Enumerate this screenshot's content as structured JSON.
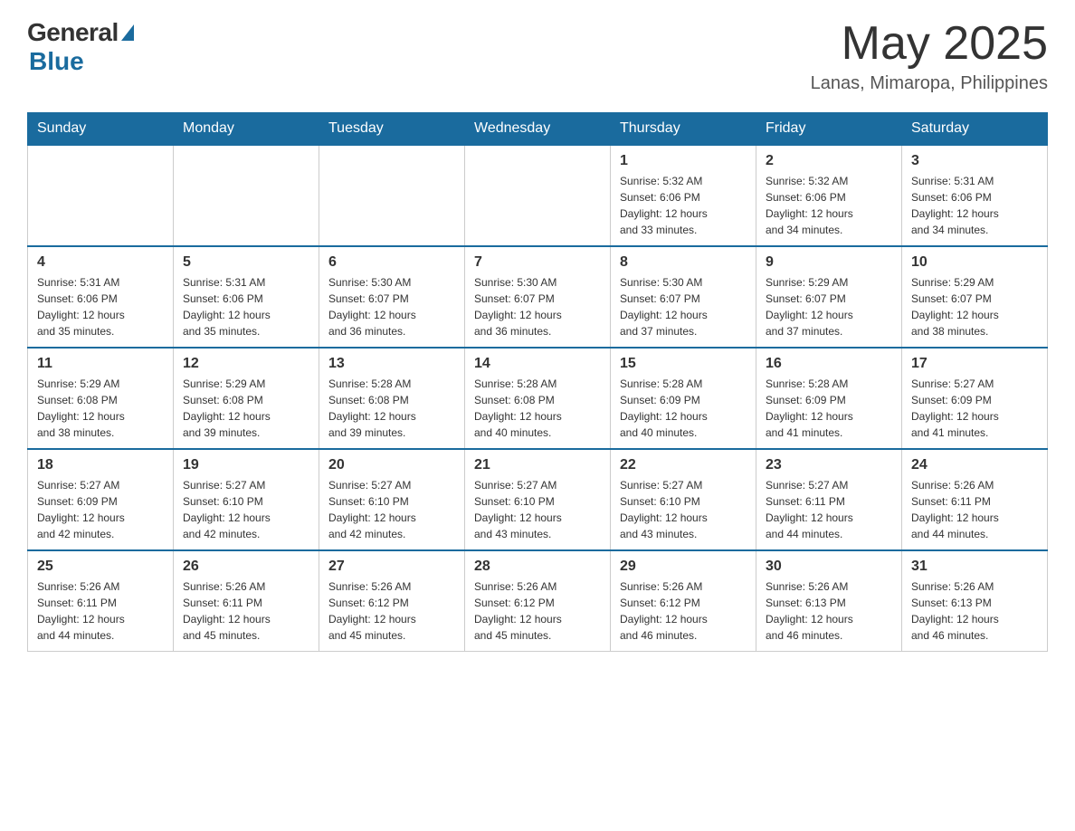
{
  "header": {
    "logo_general": "General",
    "logo_blue": "Blue",
    "month_title": "May 2025",
    "location": "Lanas, Mimaropa, Philippines"
  },
  "weekdays": [
    "Sunday",
    "Monday",
    "Tuesday",
    "Wednesday",
    "Thursday",
    "Friday",
    "Saturday"
  ],
  "weeks": [
    [
      {
        "day": "",
        "info": ""
      },
      {
        "day": "",
        "info": ""
      },
      {
        "day": "",
        "info": ""
      },
      {
        "day": "",
        "info": ""
      },
      {
        "day": "1",
        "info": "Sunrise: 5:32 AM\nSunset: 6:06 PM\nDaylight: 12 hours\nand 33 minutes."
      },
      {
        "day": "2",
        "info": "Sunrise: 5:32 AM\nSunset: 6:06 PM\nDaylight: 12 hours\nand 34 minutes."
      },
      {
        "day": "3",
        "info": "Sunrise: 5:31 AM\nSunset: 6:06 PM\nDaylight: 12 hours\nand 34 minutes."
      }
    ],
    [
      {
        "day": "4",
        "info": "Sunrise: 5:31 AM\nSunset: 6:06 PM\nDaylight: 12 hours\nand 35 minutes."
      },
      {
        "day": "5",
        "info": "Sunrise: 5:31 AM\nSunset: 6:06 PM\nDaylight: 12 hours\nand 35 minutes."
      },
      {
        "day": "6",
        "info": "Sunrise: 5:30 AM\nSunset: 6:07 PM\nDaylight: 12 hours\nand 36 minutes."
      },
      {
        "day": "7",
        "info": "Sunrise: 5:30 AM\nSunset: 6:07 PM\nDaylight: 12 hours\nand 36 minutes."
      },
      {
        "day": "8",
        "info": "Sunrise: 5:30 AM\nSunset: 6:07 PM\nDaylight: 12 hours\nand 37 minutes."
      },
      {
        "day": "9",
        "info": "Sunrise: 5:29 AM\nSunset: 6:07 PM\nDaylight: 12 hours\nand 37 minutes."
      },
      {
        "day": "10",
        "info": "Sunrise: 5:29 AM\nSunset: 6:07 PM\nDaylight: 12 hours\nand 38 minutes."
      }
    ],
    [
      {
        "day": "11",
        "info": "Sunrise: 5:29 AM\nSunset: 6:08 PM\nDaylight: 12 hours\nand 38 minutes."
      },
      {
        "day": "12",
        "info": "Sunrise: 5:29 AM\nSunset: 6:08 PM\nDaylight: 12 hours\nand 39 minutes."
      },
      {
        "day": "13",
        "info": "Sunrise: 5:28 AM\nSunset: 6:08 PM\nDaylight: 12 hours\nand 39 minutes."
      },
      {
        "day": "14",
        "info": "Sunrise: 5:28 AM\nSunset: 6:08 PM\nDaylight: 12 hours\nand 40 minutes."
      },
      {
        "day": "15",
        "info": "Sunrise: 5:28 AM\nSunset: 6:09 PM\nDaylight: 12 hours\nand 40 minutes."
      },
      {
        "day": "16",
        "info": "Sunrise: 5:28 AM\nSunset: 6:09 PM\nDaylight: 12 hours\nand 41 minutes."
      },
      {
        "day": "17",
        "info": "Sunrise: 5:27 AM\nSunset: 6:09 PM\nDaylight: 12 hours\nand 41 minutes."
      }
    ],
    [
      {
        "day": "18",
        "info": "Sunrise: 5:27 AM\nSunset: 6:09 PM\nDaylight: 12 hours\nand 42 minutes."
      },
      {
        "day": "19",
        "info": "Sunrise: 5:27 AM\nSunset: 6:10 PM\nDaylight: 12 hours\nand 42 minutes."
      },
      {
        "day": "20",
        "info": "Sunrise: 5:27 AM\nSunset: 6:10 PM\nDaylight: 12 hours\nand 42 minutes."
      },
      {
        "day": "21",
        "info": "Sunrise: 5:27 AM\nSunset: 6:10 PM\nDaylight: 12 hours\nand 43 minutes."
      },
      {
        "day": "22",
        "info": "Sunrise: 5:27 AM\nSunset: 6:10 PM\nDaylight: 12 hours\nand 43 minutes."
      },
      {
        "day": "23",
        "info": "Sunrise: 5:27 AM\nSunset: 6:11 PM\nDaylight: 12 hours\nand 44 minutes."
      },
      {
        "day": "24",
        "info": "Sunrise: 5:26 AM\nSunset: 6:11 PM\nDaylight: 12 hours\nand 44 minutes."
      }
    ],
    [
      {
        "day": "25",
        "info": "Sunrise: 5:26 AM\nSunset: 6:11 PM\nDaylight: 12 hours\nand 44 minutes."
      },
      {
        "day": "26",
        "info": "Sunrise: 5:26 AM\nSunset: 6:11 PM\nDaylight: 12 hours\nand 45 minutes."
      },
      {
        "day": "27",
        "info": "Sunrise: 5:26 AM\nSunset: 6:12 PM\nDaylight: 12 hours\nand 45 minutes."
      },
      {
        "day": "28",
        "info": "Sunrise: 5:26 AM\nSunset: 6:12 PM\nDaylight: 12 hours\nand 45 minutes."
      },
      {
        "day": "29",
        "info": "Sunrise: 5:26 AM\nSunset: 6:12 PM\nDaylight: 12 hours\nand 46 minutes."
      },
      {
        "day": "30",
        "info": "Sunrise: 5:26 AM\nSunset: 6:13 PM\nDaylight: 12 hours\nand 46 minutes."
      },
      {
        "day": "31",
        "info": "Sunrise: 5:26 AM\nSunset: 6:13 PM\nDaylight: 12 hours\nand 46 minutes."
      }
    ]
  ]
}
